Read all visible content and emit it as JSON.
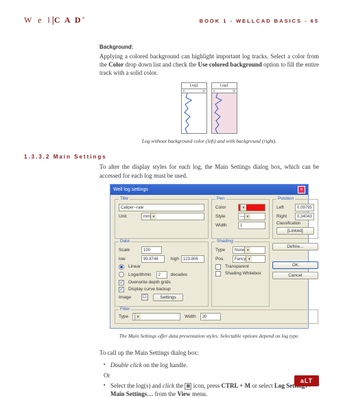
{
  "header": {
    "logo_pre": "W e l",
    "logo_bar": "|",
    "logo_post": "C A D",
    "crumb": "BOOK 1 - WELLCAD BASICS - 65"
  },
  "background": {
    "label": "Background:",
    "para": "Applying a colored background can highlight important log tracks. Select a color from the Color drop down list and check the Use colored background option to fill the entire track with a solid color."
  },
  "logs": {
    "log1_title": "Log1",
    "log2_title": "Log1",
    "scale_lo": "0",
    "scale_hi": "50",
    "caption": "Log without background color (left) and with background (right)."
  },
  "section": {
    "num": "1.3.3.2 Main Settings",
    "intro": "To alter the display styles for each log, the Main Settings dialog box, which can be accessed for each log must be used."
  },
  "dialog": {
    "title": "Well log settings",
    "groups": {
      "title_g": "Title",
      "data_g": "Data",
      "pen_g": "Pen",
      "pos_g": "Position",
      "shading_g": "Shading",
      "filter_g": "Filter"
    },
    "fields": {
      "name_val": "Caliper--rate",
      "unit_lbl": "Unit",
      "unit_val": "mm",
      "color_lbl": "Color",
      "style_lbl": "Style",
      "width_lbl": "Width",
      "width_val": "1",
      "left_lbl": "Left",
      "left_val": "0.09795",
      "right_lbl": "Right",
      "right_val": "0.34043",
      "classif_lbl": "Classification",
      "scale_lbl": "Scale",
      "scale_val": "100",
      "low_lbl": "low",
      "low_val": "99.8748",
      "high_lbl": "high",
      "high_val": "123.806",
      "type_opt_linear": "Linear",
      "type_opt_log": "Logarithmic",
      "decades_lbl": "decades",
      "decades_val": "2",
      "cb_depth_grids": "Overwrite depth grids",
      "cb_curve_backup": "Display curve backup",
      "image_lbl": "Image",
      "settings_btn": "Settings",
      "type_lbl": "Type",
      "type_val": "None",
      "pos_lbl": "Pos.",
      "pos_val": "Fancy",
      "cb_transparent": "Transparent",
      "cb_shading_whitebox": "Shading Whitebox",
      "filter_type_lbl": "Type",
      "filter_width_lbl": "Width",
      "filter_width_val": "30",
      "btn_linked": "[Linked]",
      "btn_define": "Define...",
      "btn_ok": "OK",
      "btn_cancel": "Cancel"
    },
    "caption": "The Main Settings offer data presentation styles. Selectable options depend on log type."
  },
  "callup": {
    "intro": "To call up the Main Settings dialog box:",
    "b1_pre": "Double click",
    "b1_post": " on the log handle.",
    "or": "Or",
    "b2_pre": "Select the log(s) and ",
    "b2_click": "click",
    "b2_mid": " the ",
    "b2_post1": " icon, press ",
    "b2_ctrl": "CTRL + M",
    "b2_post2": " or select ",
    "b2_logset": "Log Settings > Main Settings…",
    "b2_post3": " from the ",
    "b2_view": "View",
    "b2_post4": " menu."
  },
  "footer": {
    "logo": "aLT"
  }
}
